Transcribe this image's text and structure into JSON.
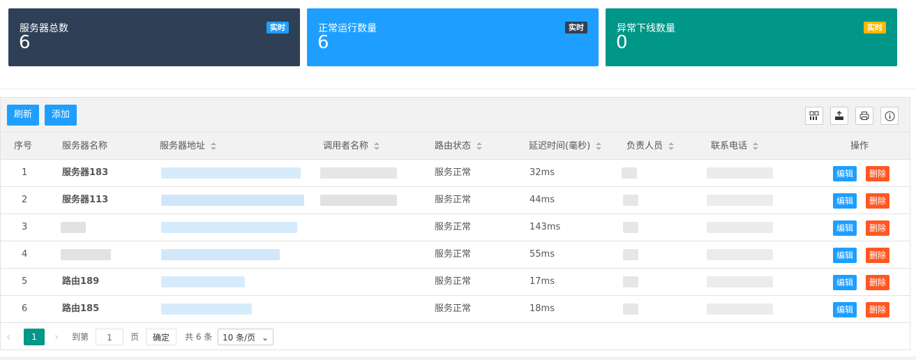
{
  "cards": [
    {
      "label": "服务器总数",
      "value": "6",
      "badge": "实时",
      "bg": "#2f4056",
      "badge_bg": "#1e9fff",
      "badge_color": "#ffffff"
    },
    {
      "label": "正常运行数量",
      "value": "6",
      "badge": "实时",
      "bg": "#1e9fff",
      "badge_bg": "#2f4056",
      "badge_color": "#ffffff"
    },
    {
      "label": "异常下线数量",
      "value": "0",
      "badge": "实时",
      "bg": "#009688",
      "badge_bg": "#ffb800",
      "badge_color": "#ffffff"
    }
  ],
  "toolbar": {
    "refresh_label": "刷新",
    "add_label": "添加",
    "icons": [
      "columns-icon",
      "export-icon",
      "print-icon",
      "info-icon"
    ]
  },
  "table": {
    "headers": {
      "index": "序号",
      "name": "服务器名称",
      "address": "服务器地址",
      "caller": "调用者名称",
      "route_status": "路由状态",
      "latency": "延迟时间(毫秒)",
      "owner": "负责人员",
      "phone": "联系电话",
      "actions": "操作"
    },
    "edit_label": "编辑",
    "delete_label": "删除",
    "rows": [
      {
        "index": "1",
        "name": "服务器183",
        "status": "服务正常",
        "latency": "32ms"
      },
      {
        "index": "2",
        "name": "服务器113",
        "status": "服务正常",
        "latency": "44ms"
      },
      {
        "index": "3",
        "name": "",
        "status": "服务正常",
        "latency": "143ms"
      },
      {
        "index": "4",
        "name": "",
        "status": "服务正常",
        "latency": "55ms"
      },
      {
        "index": "5",
        "name": "路由189",
        "status": "服务正常",
        "latency": "17ms"
      },
      {
        "index": "6",
        "name": "路由185",
        "status": "服务正常",
        "latency": "18ms"
      }
    ]
  },
  "pager": {
    "current_page": "1",
    "goto_label": "到第",
    "page_input": "1",
    "page_unit": "页",
    "confirm_label": "确定",
    "total_label": "共 6 条",
    "page_size": "10 条/页"
  },
  "colors": {
    "primary": "#1e9fff",
    "danger": "#ff5722",
    "teal": "#009688",
    "dark": "#2f4056"
  }
}
